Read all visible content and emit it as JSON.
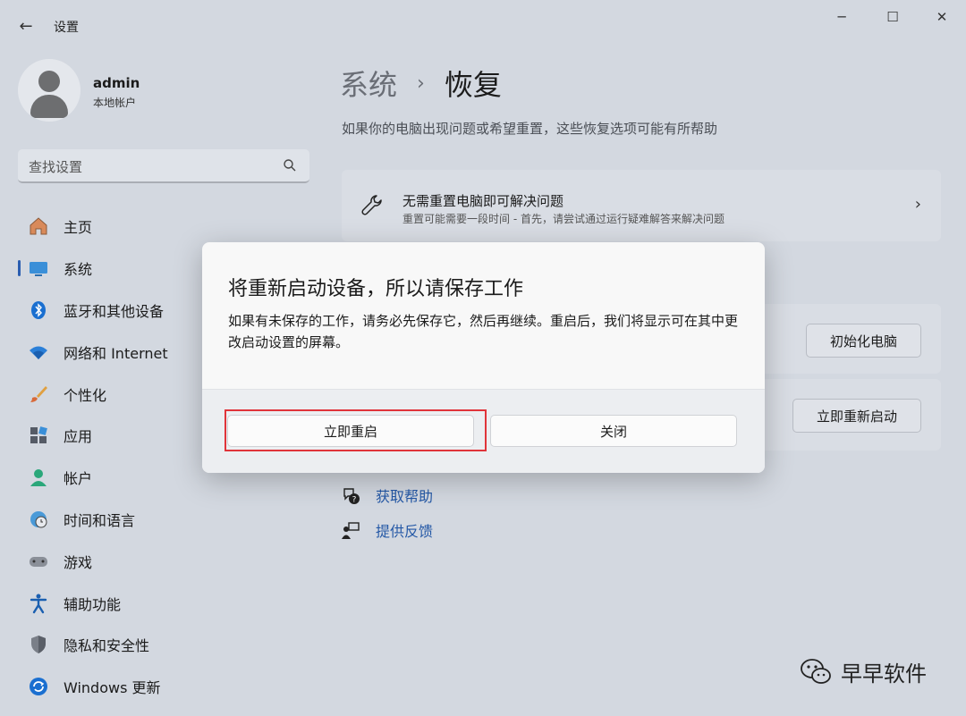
{
  "window": {
    "title": "设置",
    "back_glyph": "←",
    "minimize_glyph": "─",
    "maximize_glyph": "☐",
    "close_glyph": "✕"
  },
  "profile": {
    "name": "admin",
    "account_type": "本地帐户"
  },
  "search": {
    "placeholder": "查找设置"
  },
  "sidebar": {
    "active_index": 1,
    "items": [
      {
        "label": "主页",
        "icon": "home-icon"
      },
      {
        "label": "系统",
        "icon": "system-icon"
      },
      {
        "label": "蓝牙和其他设备",
        "icon": "bluetooth-icon"
      },
      {
        "label": "网络和 Internet",
        "icon": "wifi-icon"
      },
      {
        "label": "个性化",
        "icon": "brush-icon"
      },
      {
        "label": "应用",
        "icon": "apps-icon"
      },
      {
        "label": "帐户",
        "icon": "account-icon"
      },
      {
        "label": "时间和语言",
        "icon": "clock-globe-icon"
      },
      {
        "label": "游戏",
        "icon": "gamepad-icon"
      },
      {
        "label": "辅助功能",
        "icon": "accessibility-icon"
      },
      {
        "label": "隐私和安全性",
        "icon": "shield-icon"
      },
      {
        "label": "Windows 更新",
        "icon": "update-icon"
      }
    ]
  },
  "main": {
    "breadcrumb_parent": "系统",
    "breadcrumb_sep": "›",
    "breadcrumb_current": "恢复",
    "description": "如果你的电脑出现问题或希望重置，这些恢复选项可能有所帮助",
    "fix_card": {
      "title": "无需重置电脑即可解决问题",
      "subtitle": "重置可能需要一段时间 - 首先，请尝试通过运行疑难解答来解决问题",
      "chevron": "›"
    },
    "reset_button": "初始化电脑",
    "restart_button": "立即重新启动",
    "get_help": "获取帮助",
    "feedback": "提供反馈"
  },
  "dialog": {
    "title": "将重新启动设备，所以请保存工作",
    "body": "如果有未保存的工作，请务必先保存它，然后再继续。重启后，我们将显示可在其中更改启动设置的屏幕。",
    "primary_button": "立即重启",
    "secondary_button": "关闭"
  },
  "watermark": {
    "text": "早早软件"
  },
  "colors": {
    "accent": "#2a5db0",
    "link": "#2458a6",
    "highlight": "#e0343a"
  }
}
